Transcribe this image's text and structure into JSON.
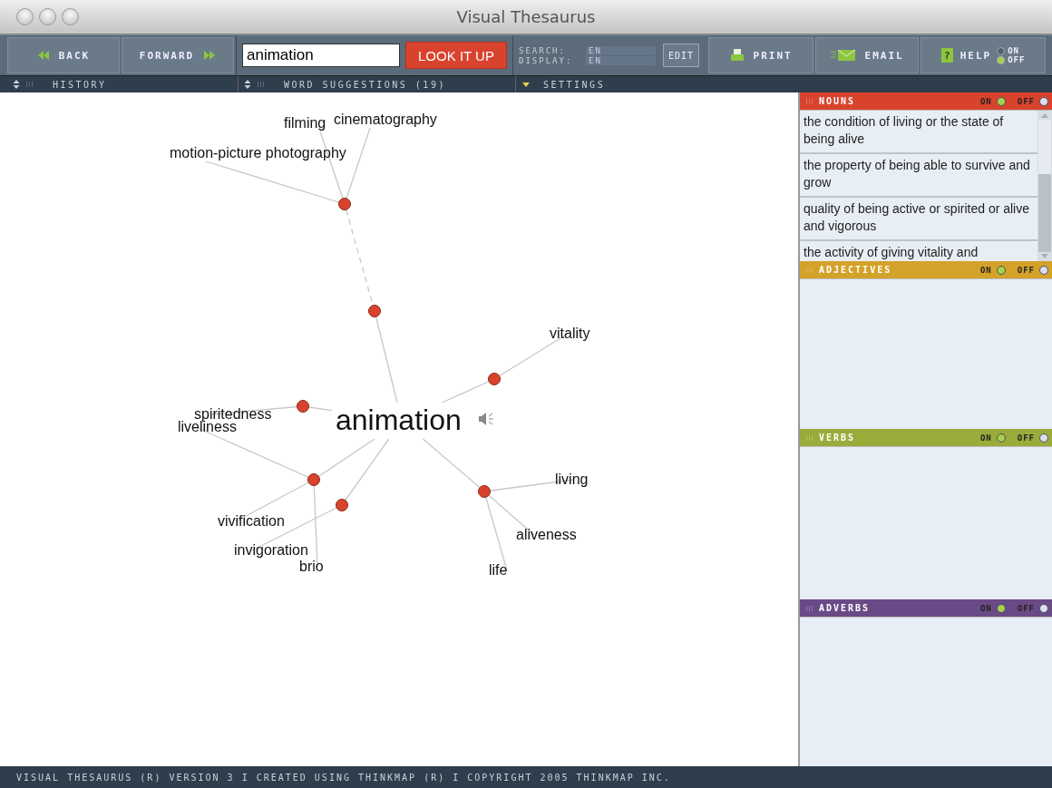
{
  "window": {
    "title": "Visual Thesaurus"
  },
  "toolbar": {
    "back": "BACK",
    "forward": "FORWARD",
    "search_value": "animation",
    "lookup": "LOOK IT UP",
    "search_label": "SEARCH:",
    "search_lang": "EN",
    "display_label": "DISPLAY:",
    "display_lang": "EN",
    "edit": "EDIT",
    "print": "PRINT",
    "email": "EMAIL",
    "help": "HELP",
    "help_icon": "?",
    "help_on_label": "ON",
    "help_off_label": "OFF",
    "help_on": false
  },
  "subbar": [
    {
      "kind": "updown",
      "label": "HISTORY"
    },
    {
      "kind": "updown",
      "label": "WORD SUGGESTIONS (19)"
    },
    {
      "kind": "dropdown",
      "label": "SETTINGS"
    }
  ],
  "graph": {
    "word": "animation",
    "meanings": [
      {
        "children": [
          {
            "words": [
              "filming",
              "cinematography",
              "motion-picture photography"
            ]
          }
        ]
      },
      {
        "words": [
          "vitality"
        ]
      },
      {
        "words": [
          "spiritedness"
        ]
      },
      {
        "words": [
          "liveliness",
          "vivification",
          "brio"
        ]
      },
      {
        "words": [
          "invigoration"
        ]
      },
      {
        "words": [
          "living",
          "aliveness",
          "life"
        ]
      }
    ]
  },
  "panels": [
    {
      "title": "NOUNS",
      "color": "#d9432e",
      "on_label": "ON",
      "off_label": "OFF",
      "on": true,
      "items": [
        "the condition of living or the state of being alive",
        "the property of being able to survive and grow",
        "quality of being active or spirited or alive and vigorous",
        "the activity of giving vitality and"
      ]
    },
    {
      "title": "ADJECTIVES",
      "color": "#d4a229",
      "on_label": "ON",
      "off_label": "OFF",
      "on": true
    },
    {
      "title": "VERBS",
      "color": "#9aab3a",
      "on_label": "ON",
      "off_label": "OFF",
      "on": true
    },
    {
      "title": "ADVERBS",
      "color": "#6a4a86",
      "on_label": "ON",
      "off_label": "OFF",
      "on": true
    }
  ],
  "footer": "VISUAL THESAURUS (R) VERSION 3 I CREATED USING THINKMAP (R) I COPYRIGHT 2005 THINKMAP INC."
}
